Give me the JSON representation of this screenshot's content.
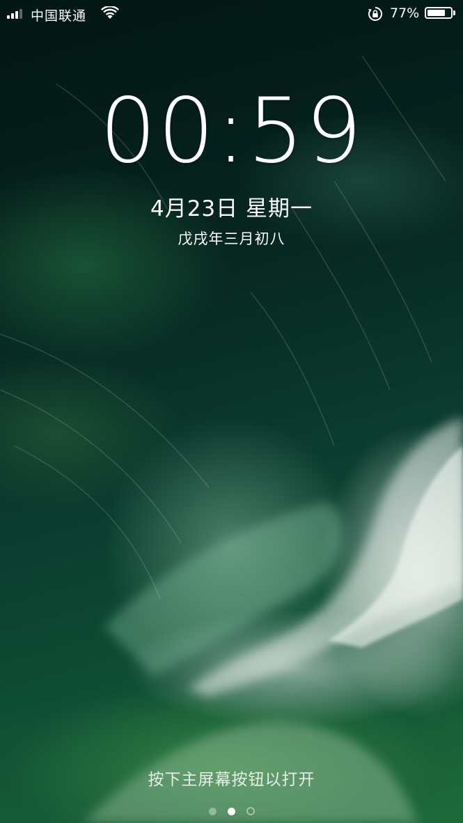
{
  "status_bar": {
    "carrier": "中国联通",
    "signal_bars_filled": 3,
    "signal_bars_total": 4,
    "battery_percent": "77%",
    "battery_level": 0.77,
    "icons": [
      "signal-icon",
      "wifi-icon",
      "rotation-lock-icon",
      "battery-icon"
    ]
  },
  "lock_screen": {
    "time": "00:59",
    "date": "4月23日 星期一",
    "lunar_date": "戊戌年三月初八",
    "unlock_hint": "按下主屏幕按钮以打开"
  },
  "page_indicator": {
    "pages": 3,
    "active_index": 1
  },
  "colors": {
    "text": "#ffffff",
    "wallpaper_dark": "#031613",
    "wallpaper_green": "#1f6a3a",
    "foam": "#e6ebe6"
  }
}
